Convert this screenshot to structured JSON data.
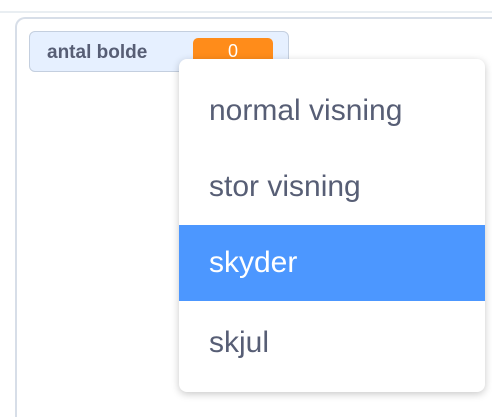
{
  "monitor": {
    "label": "antal bolde",
    "value": "0"
  },
  "context_menu": {
    "items": [
      {
        "label": "normal visning",
        "selected": false
      },
      {
        "label": "stor visning",
        "selected": false
      },
      {
        "label": "skyder",
        "selected": true
      },
      {
        "label": "skjul",
        "selected": false
      }
    ]
  },
  "colors": {
    "selection": "#4c97ff",
    "value_badge": "#ff8c1a",
    "text": "#575e75"
  }
}
